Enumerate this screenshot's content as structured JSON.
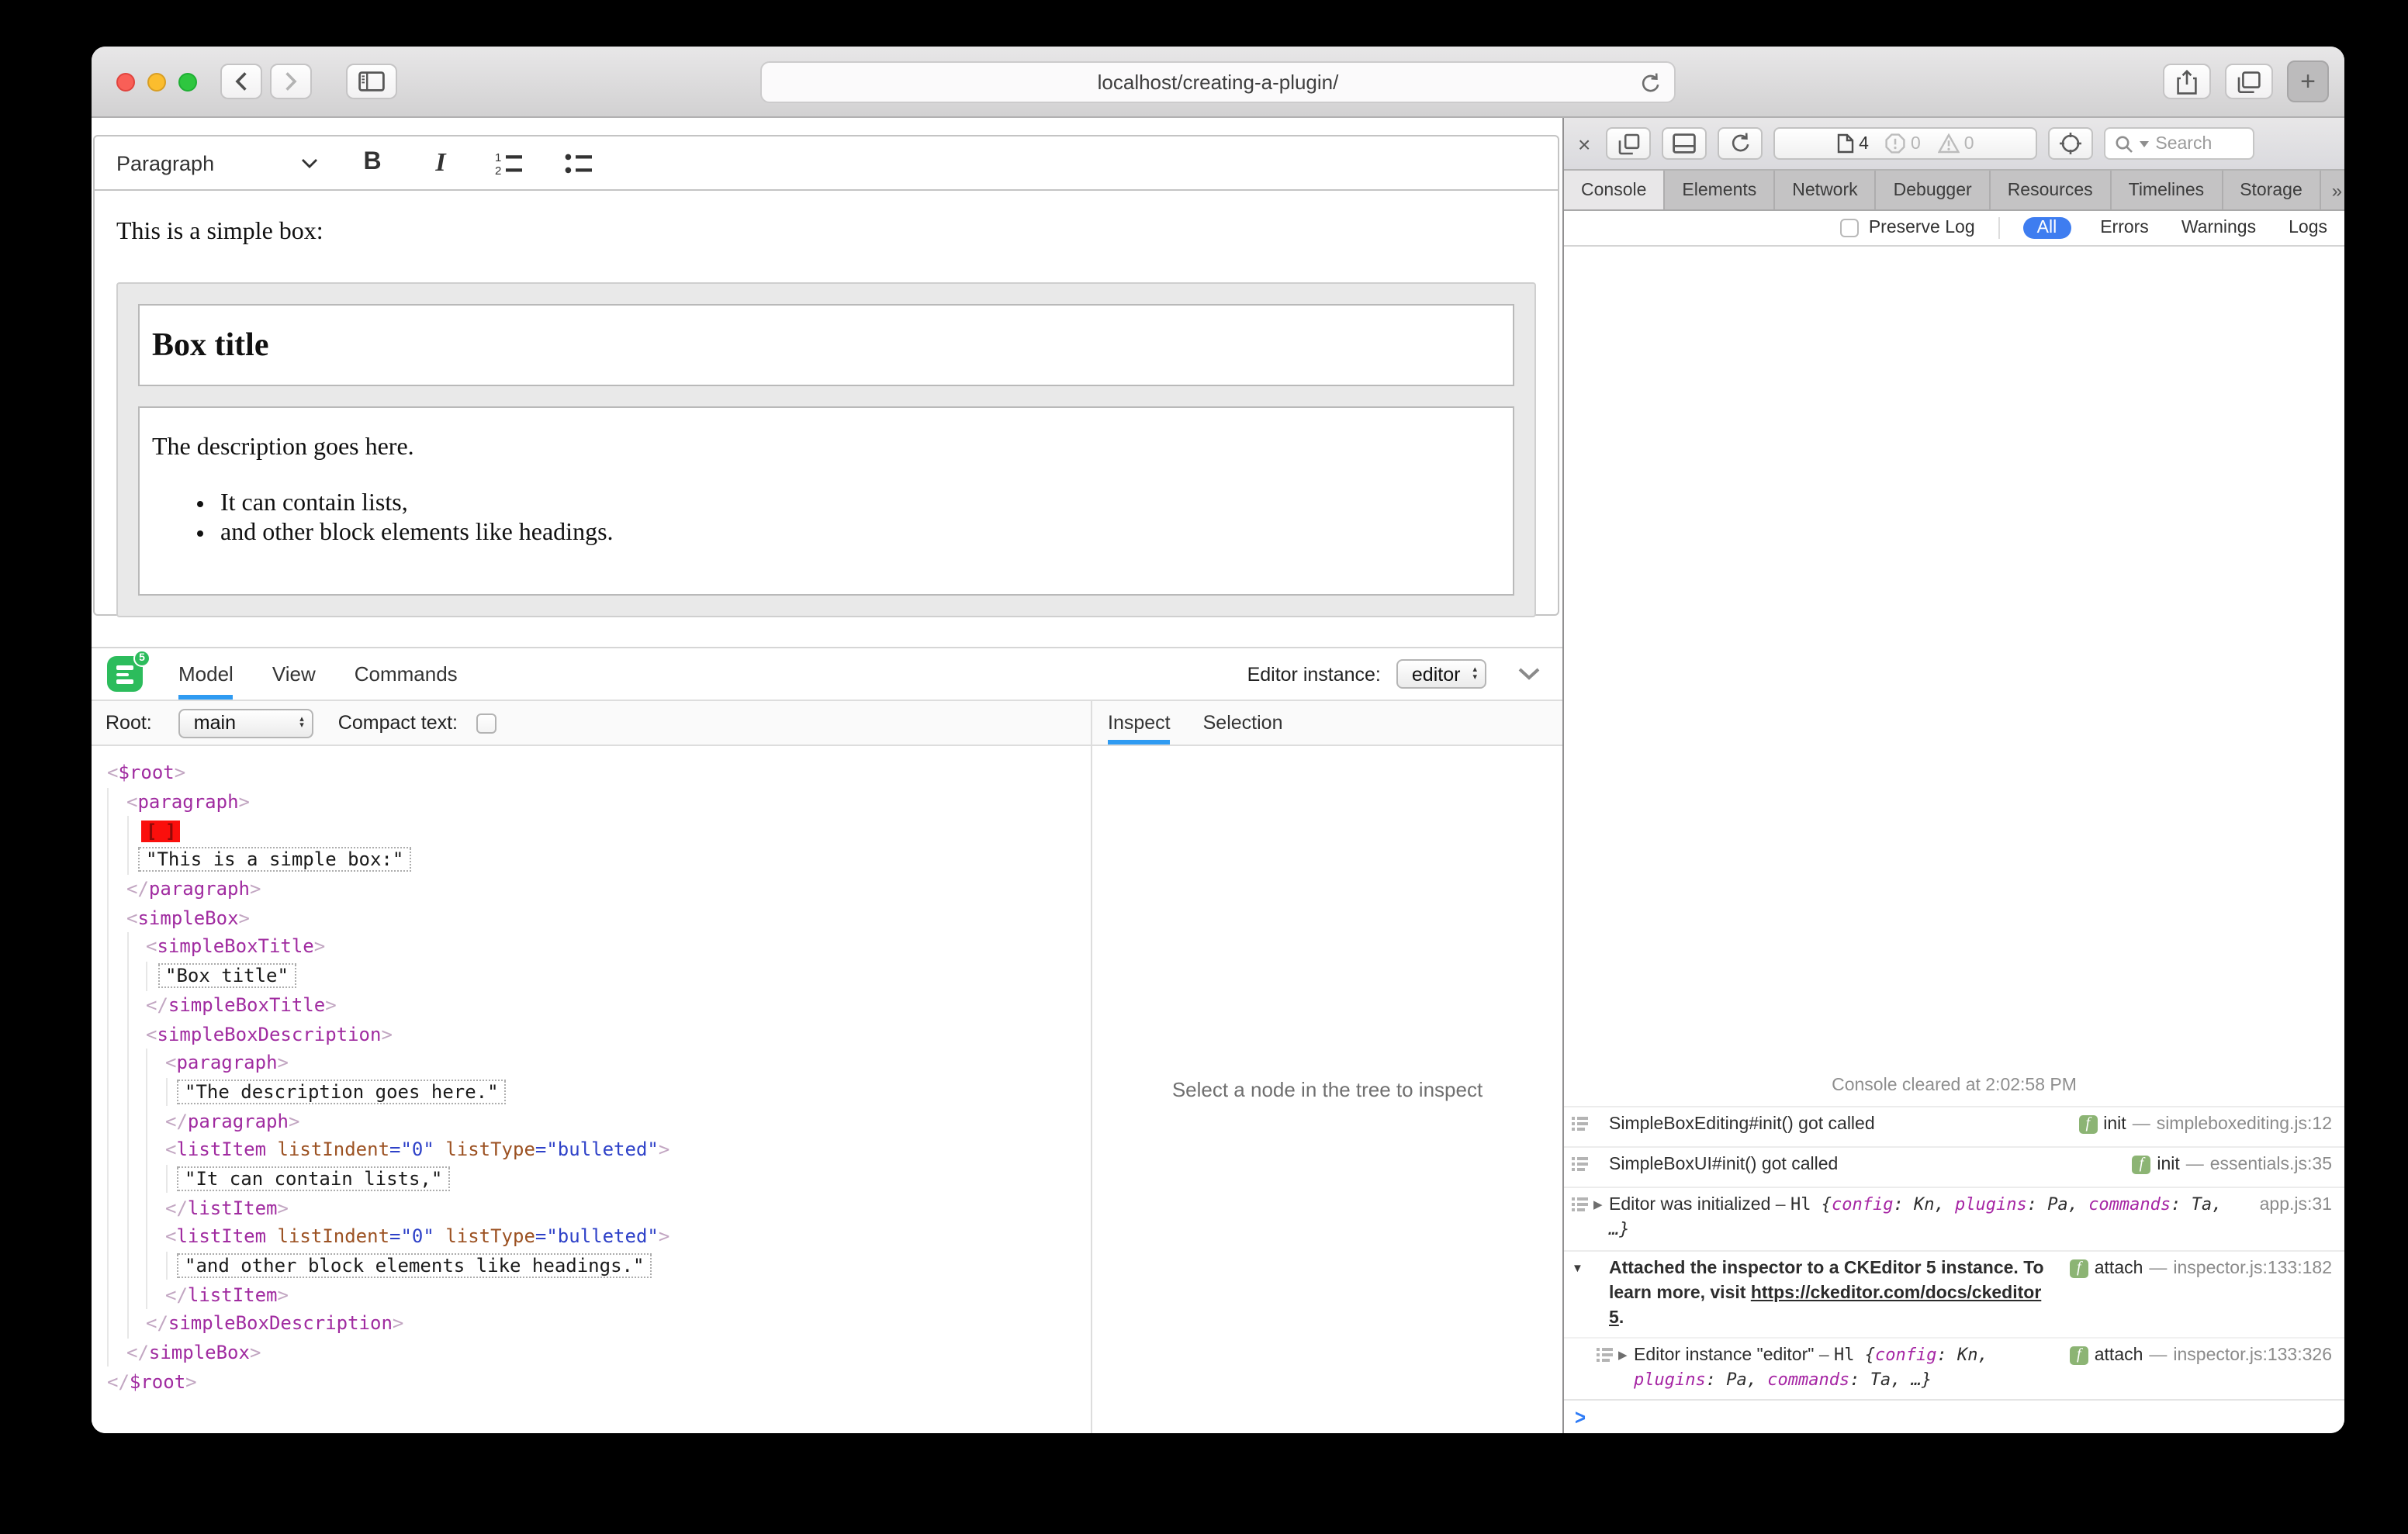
{
  "browser": {
    "url_text": "localhost/creating-a-plugin/",
    "new_tab": "+"
  },
  "editor": {
    "toolbar": {
      "style_dropdown": "Paragraph",
      "bold": "B",
      "italic": "I"
    },
    "content": {
      "intro": "This is a simple box:",
      "box_title": "Box title",
      "box_description": "The description goes here.",
      "box_list_items": [
        "It can contain lists,",
        "and other block elements like headings."
      ]
    }
  },
  "cke_inspector": {
    "logo_badge": "5",
    "tabs": [
      "Model",
      "View",
      "Commands"
    ],
    "active_tab": "Model",
    "editor_instance_label": "Editor instance:",
    "editor_instance_value": "editor",
    "root_label": "Root:",
    "root_value": "main",
    "compact_text_label": "Compact text:",
    "side_tabs": [
      "Inspect",
      "Selection"
    ],
    "active_side_tab": "Inspect",
    "empty_state": "Select a node in the tree to inspect",
    "tree": [
      {
        "type": "open",
        "depth": 0,
        "name": "$root"
      },
      {
        "type": "open",
        "depth": 1,
        "name": "paragraph"
      },
      {
        "type": "selection",
        "depth": 2,
        "label": "[ ]"
      },
      {
        "type": "text",
        "depth": 2,
        "value": "\"This is a simple box:\""
      },
      {
        "type": "close",
        "depth": 1,
        "name": "paragraph"
      },
      {
        "type": "open",
        "depth": 1,
        "name": "simpleBox"
      },
      {
        "type": "open",
        "depth": 2,
        "name": "simpleBoxTitle"
      },
      {
        "type": "text",
        "depth": 3,
        "value": "\"Box title\""
      },
      {
        "type": "close",
        "depth": 2,
        "name": "simpleBoxTitle"
      },
      {
        "type": "open",
        "depth": 2,
        "name": "simpleBoxDescription"
      },
      {
        "type": "open",
        "depth": 3,
        "name": "paragraph"
      },
      {
        "type": "text",
        "depth": 4,
        "value": "\"The description goes here.\""
      },
      {
        "type": "close",
        "depth": 3,
        "name": "paragraph"
      },
      {
        "type": "open",
        "depth": 3,
        "name": "listItem",
        "attrs": [
          {
            "name": "listIndent",
            "value": "0"
          },
          {
            "name": "listType",
            "value": "bulleted"
          }
        ]
      },
      {
        "type": "text",
        "depth": 4,
        "value": "\"It can contain lists,\""
      },
      {
        "type": "close",
        "depth": 3,
        "name": "listItem"
      },
      {
        "type": "open",
        "depth": 3,
        "name": "listItem",
        "attrs": [
          {
            "name": "listIndent",
            "value": "0"
          },
          {
            "name": "listType",
            "value": "bulleted"
          }
        ]
      },
      {
        "type": "text",
        "depth": 4,
        "value": "\"and other block elements like headings.\""
      },
      {
        "type": "close",
        "depth": 3,
        "name": "listItem"
      },
      {
        "type": "close",
        "depth": 2,
        "name": "simpleBoxDescription"
      },
      {
        "type": "close",
        "depth": 1,
        "name": "simpleBox"
      },
      {
        "type": "close",
        "depth": 0,
        "name": "$root"
      }
    ]
  },
  "devtools": {
    "toolbar": {
      "page_count": "4",
      "error_count": "0",
      "warning_count": "0",
      "search_placeholder": "Search"
    },
    "tabs": [
      "Console",
      "Elements",
      "Network",
      "Debugger",
      "Resources",
      "Timelines",
      "Storage"
    ],
    "active_tab": "Console",
    "overflow_glyph": "»",
    "add_tab_glyph": "+",
    "filter": {
      "preserve_log": "Preserve Log",
      "scopes": [
        "All",
        "Errors",
        "Warnings",
        "Logs"
      ],
      "active_scope": "All"
    },
    "console": {
      "cleared_text": "Console cleared at 2:02:58 PM",
      "meta_separator": "—",
      "prompt_glyph": ">",
      "messages": [
        {
          "icon": true,
          "disclosure": null,
          "bold": false,
          "nested": false,
          "parts": [
            [
              "plain",
              "SimpleBoxEditing#init() got called"
            ]
          ],
          "meta": {
            "fn": "init",
            "location": "simpleboxediting.js:12"
          }
        },
        {
          "icon": true,
          "disclosure": null,
          "bold": false,
          "nested": false,
          "parts": [
            [
              "plain",
              "SimpleBoxUI#init() got called"
            ]
          ],
          "meta": {
            "fn": "init",
            "location": "essentials.js:35"
          }
        },
        {
          "icon": true,
          "disclosure": "collapsed",
          "bold": false,
          "nested": false,
          "parts": [
            [
              "plain",
              "Editor was initialized "
            ],
            [
              "sep",
              "– "
            ],
            [
              "mono",
              "Hl "
            ],
            [
              "code",
              "{"
            ],
            [
              "key",
              "config"
            ],
            [
              "code",
              ": "
            ],
            [
              "cval",
              "Kn"
            ],
            [
              "code",
              ", "
            ],
            [
              "key",
              "plugins"
            ],
            [
              "code",
              ": "
            ],
            [
              "cval",
              "Pa"
            ],
            [
              "code",
              ", "
            ],
            [
              "key",
              "commands"
            ],
            [
              "code",
              ": "
            ],
            [
              "cval",
              "Ta"
            ],
            [
              "code",
              ", …}"
            ]
          ],
          "meta": {
            "location": "app.js:31"
          }
        },
        {
          "icon": false,
          "disclosure": "expanded",
          "bold": true,
          "nested": false,
          "parts": [
            [
              "plain",
              "Attached the inspector to a CKEditor 5 instance. To learn more, visit "
            ],
            [
              "link",
              "https://ckeditor.com/docs/ckeditor5"
            ],
            [
              "plain",
              "."
            ]
          ],
          "meta": {
            "fn": "attach",
            "location": "inspector.js:133:182"
          }
        },
        {
          "icon": true,
          "disclosure": "collapsed",
          "bold": false,
          "nested": true,
          "parts": [
            [
              "plain",
              "Editor instance \"editor\" "
            ],
            [
              "sep",
              "– "
            ],
            [
              "mono",
              "Hl "
            ],
            [
              "code",
              "{"
            ],
            [
              "key",
              "config"
            ],
            [
              "code",
              ": "
            ],
            [
              "cval",
              "Kn"
            ],
            [
              "code",
              ", "
            ],
            [
              "key",
              "plugins"
            ],
            [
              "code",
              ": "
            ],
            [
              "cval",
              "Pa"
            ],
            [
              "code",
              ", "
            ],
            [
              "key",
              "commands"
            ],
            [
              "code",
              ": "
            ],
            [
              "cval",
              "Ta"
            ],
            [
              "code",
              ", …}"
            ]
          ],
          "meta": {
            "fn": "attach",
            "location": "inspector.js:133:326"
          }
        }
      ]
    }
  },
  "colors": {
    "accent_blue": "#2f9bf2",
    "pill_blue": "#3e7df0",
    "tag_purple": "#a02ba0",
    "attr_orange": "#9c5223",
    "attr_value_blue": "#2e41c8",
    "selection_red": "#fa0f0c",
    "badge_green": "#8cb474",
    "ckeditor_green": "#2cbc5c"
  }
}
